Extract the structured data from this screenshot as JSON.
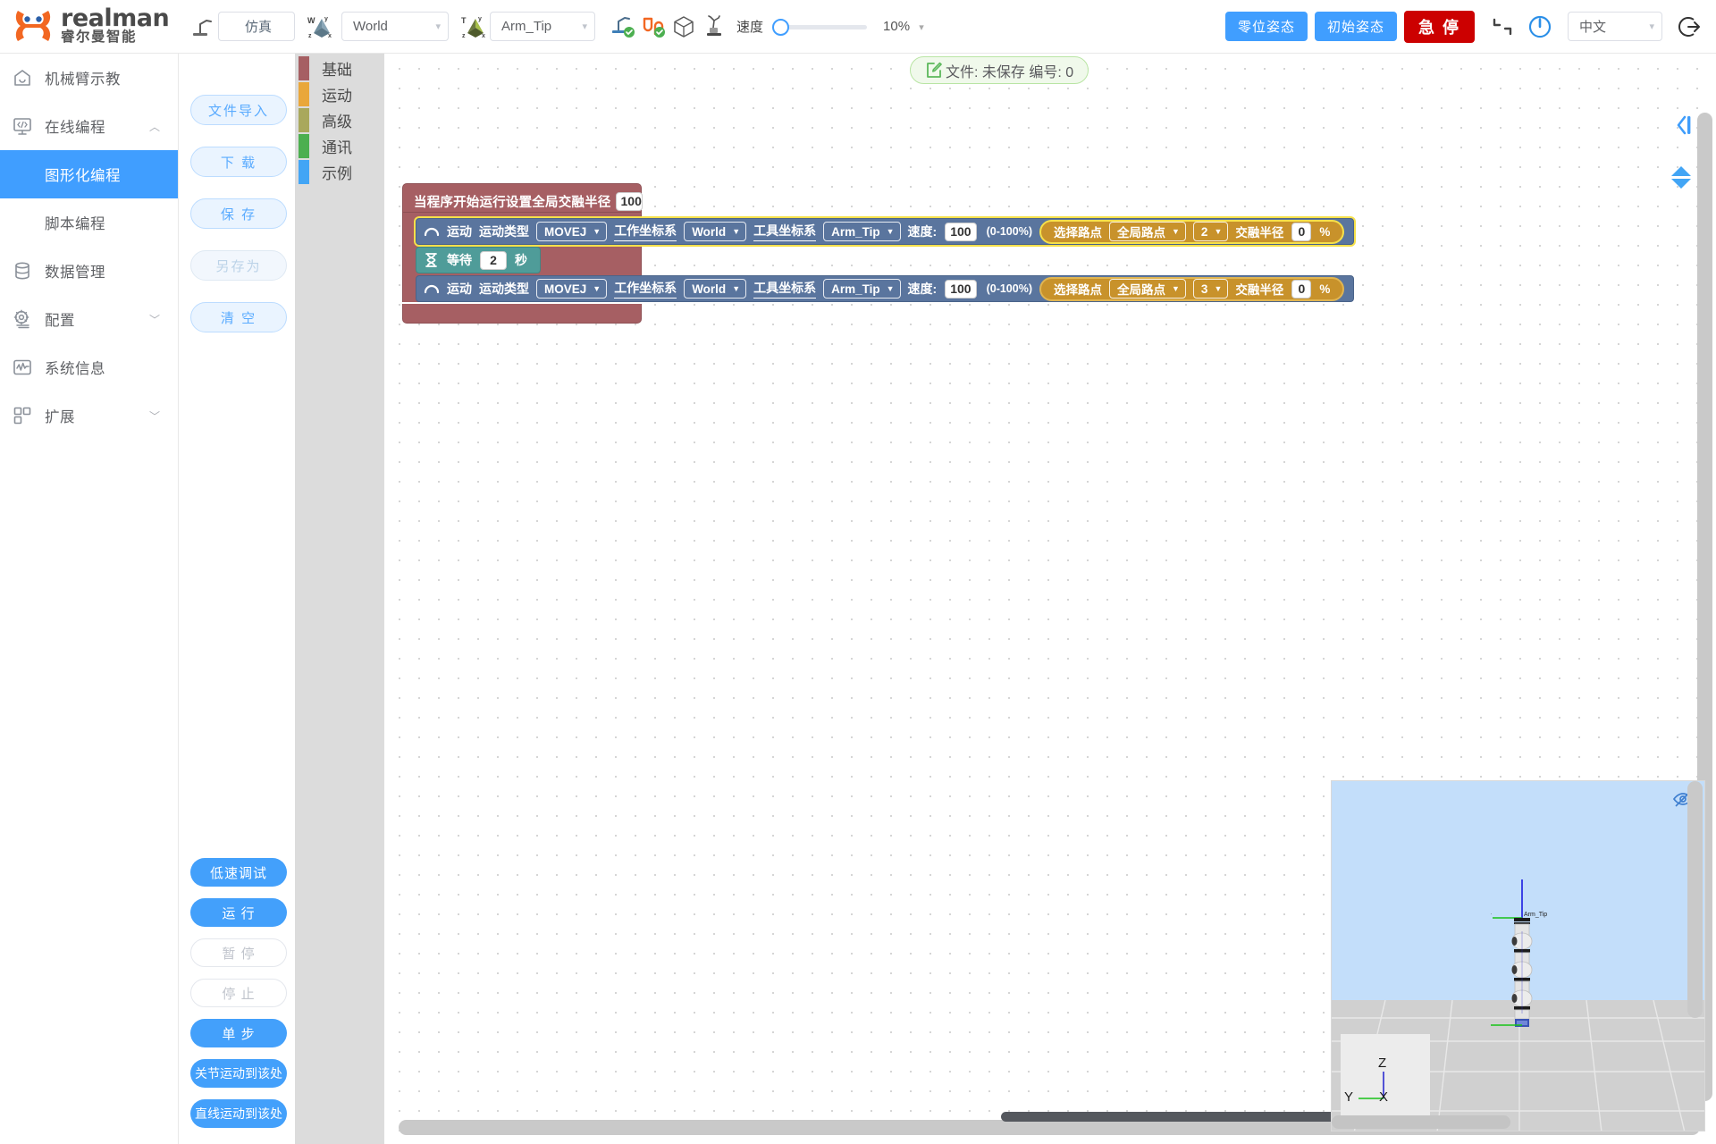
{
  "brand": {
    "en": "realman",
    "cn": "睿尔曼智能"
  },
  "topbar": {
    "robot_icon": "robot-arm-icon",
    "mode_label": "仿真",
    "work_frame_icon": "world-axis-icon",
    "work_frame_value": "World",
    "tool_frame_icon": "tool-axis-icon",
    "tool_frame_value": "Arm_Tip",
    "status_icons": [
      "robot-connected-icon",
      "cable-connected-icon",
      "cube-icon",
      "collision-icon"
    ],
    "speed_label": "速度",
    "speed_percent": "10%",
    "zero_pose_label": "零位姿态",
    "init_pose_label": "初始姿态",
    "estop_label": "急 停",
    "reset_icon": "reset-icon",
    "power_icon": "power-icon",
    "language_value": "中文",
    "logout_icon": "logout-icon"
  },
  "sidebar": {
    "items": [
      {
        "label": "机械臂示教",
        "icon": "home-icon",
        "chevron": ""
      },
      {
        "label": "在线编程",
        "icon": "code-monitor-icon",
        "chevron": "︿"
      },
      {
        "label": "数据管理",
        "icon": "database-icon",
        "chevron": ""
      },
      {
        "label": "配置",
        "icon": "gear-icon",
        "chevron": "﹀"
      },
      {
        "label": "系统信息",
        "icon": "pulse-icon",
        "chevron": ""
      },
      {
        "label": "扩展",
        "icon": "grid-icon",
        "chevron": "﹀"
      }
    ],
    "sub_items": [
      {
        "label": "图形化编程",
        "active": true
      },
      {
        "label": "脚本编程",
        "active": false
      }
    ]
  },
  "file_panel": {
    "buttons": [
      {
        "label": "文件导入",
        "disabled": false
      },
      {
        "label": "下 载",
        "disabled": false
      },
      {
        "label": "保 存",
        "disabled": false
      },
      {
        "label": "另存为",
        "disabled": true
      },
      {
        "label": "清 空",
        "disabled": false
      }
    ]
  },
  "run_panel": {
    "buttons": [
      {
        "label": "低速调试",
        "state": "on",
        "small": false
      },
      {
        "label": "运 行",
        "state": "on",
        "small": false
      },
      {
        "label": "暂 停",
        "state": "off",
        "small": false
      },
      {
        "label": "停 止",
        "state": "off",
        "small": false
      },
      {
        "label": "单 步",
        "state": "on",
        "small": false
      },
      {
        "label": "关节运动到该处",
        "state": "on",
        "small": true
      },
      {
        "label": "直线运动到该处",
        "state": "on",
        "small": true
      }
    ]
  },
  "toolbox": {
    "categories": [
      {
        "label": "基础",
        "color": "#a65f63"
      },
      {
        "label": "运动",
        "color": "#eaa game"
      },
      {
        "label": "高级",
        "color": "#a9a85c"
      },
      {
        "label": "通讯",
        "color": "#4caf50"
      },
      {
        "label": "示例",
        "color": "#42a5f5"
      }
    ],
    "colors": [
      "#a65f63",
      "#e9a73b",
      "#a9a85c",
      "#4caf50",
      "#42a5f5"
    ]
  },
  "file_status": {
    "icon": "edit-file-icon",
    "text": "文件: 未保存  编号: 0"
  },
  "program": {
    "start_block": {
      "text_1": "当程序开始运行",
      "text_2": "设置全局交融半径",
      "blend_radius": "100",
      "unit": "%"
    },
    "blocks": [
      {
        "type": "motion",
        "icon": "arc-motion-icon",
        "label_motion": "运动",
        "label_type": "运动类型",
        "motion_type": "MOVEJ",
        "label_work_frame": "工作坐标系",
        "work_frame": "World",
        "label_tool_frame": "工具坐标系",
        "tool_frame": "Arm_Tip",
        "label_speed": "速度:",
        "speed": "100",
        "speed_hint": "(0-100%)",
        "label_pick_point": "选择路点",
        "point_source": "全局路点",
        "point_index": "2",
        "label_blend": "交融半径",
        "blend": "0",
        "blend_unit": "%",
        "selected": true
      },
      {
        "type": "wait",
        "icon": "hourglass-icon",
        "label_wait": "等待",
        "seconds": "2",
        "label_unit": "秒"
      },
      {
        "type": "motion",
        "icon": "arc-motion-icon",
        "label_motion": "运动",
        "label_type": "运动类型",
        "motion_type": "MOVEJ",
        "label_work_frame": "工作坐标系",
        "work_frame": "World",
        "label_tool_frame": "工具坐标系",
        "tool_frame": "Arm_Tip",
        "label_speed": "速度:",
        "speed": "100",
        "speed_hint": "(0-100%)",
        "label_pick_point": "选择路点",
        "point_source": "全局路点",
        "point_index": "3",
        "label_blend": "交融半径",
        "blend": "0",
        "blend_unit": "%",
        "selected": false
      }
    ]
  },
  "canvas_controls": {
    "collapse_icon": "collapse-panel-icon",
    "scroll_up_icon": "triangle-up-icon",
    "scroll_down_icon": "triangle-down-icon"
  },
  "viewport": {
    "eye_icon": "hide-eye-icon",
    "tip_label": "Arm_Tip",
    "tip_axis_z": "z",
    "tip_axis_y": "y",
    "axis_x": "X",
    "axis_y": "Y",
    "axis_z": "Z"
  }
}
